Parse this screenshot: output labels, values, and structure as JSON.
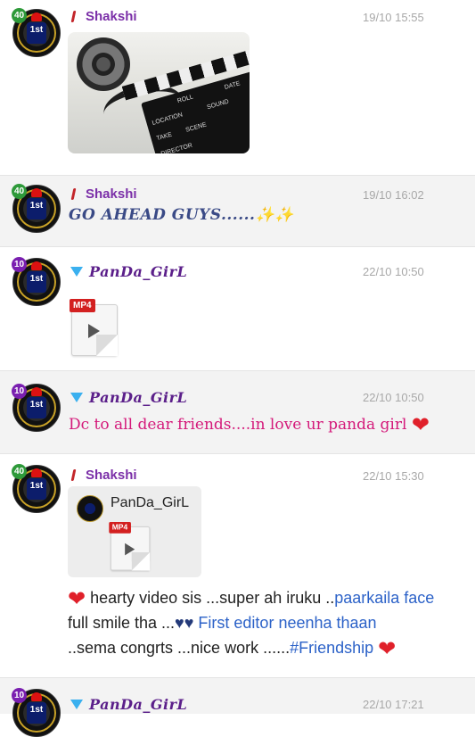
{
  "messages": [
    {
      "sender": "Shakshi",
      "level": "40",
      "time": "19/10 15:55",
      "type": "image"
    },
    {
      "sender": "Shakshi",
      "level": "40",
      "time": "19/10 16:02",
      "text": "GO AHEAD GUYS......",
      "sparkles": "✨✨"
    },
    {
      "sender": "PanDa_GirL",
      "level": "10",
      "time": "22/10 10:50",
      "type": "file",
      "file_tag": "MP4"
    },
    {
      "sender": "PanDa_GirL",
      "level": "10",
      "time": "22/10 10:50",
      "text": "Dc to all dear friends....in love ur panda girl"
    },
    {
      "sender": "Shakshi",
      "level": "40",
      "time": "22/10 15:30",
      "quoted_sender": "PanDa_GirL",
      "quoted_file_tag": "MP4",
      "line1_a": " hearty video sis ...super ah iruku ..",
      "line1_b": "paarkaila face",
      "line2_a": "full smile tha ...",
      "line2_b": " First editor neenha thaan",
      "line3_a": "..sema congrts ...nice work ......",
      "line3_b": "#Friendship"
    },
    {
      "sender": "PanDa_GirL",
      "level": "10",
      "time": "22/10 17:21"
    }
  ],
  "photo_labels": {
    "roll": "ROLL",
    "date": "DATE",
    "location": "LOCATION",
    "sound": "SOUND",
    "take": "TAKE",
    "scene": "SCENE",
    "director": "DIRECTOR"
  },
  "icons": {
    "heart": "❤",
    "blue_heart": "💙"
  },
  "colors": {
    "shakshi_name": "#7b2fa8",
    "panda_name": "#5b1f8a",
    "pink_text": "#d4197a",
    "link_blue": "#2c62c8",
    "timestamp": "#a8a8a8"
  }
}
